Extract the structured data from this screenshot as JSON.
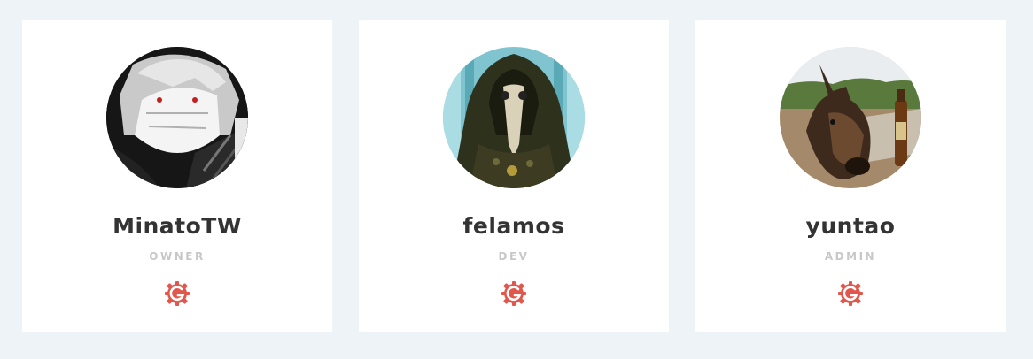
{
  "team": {
    "members": [
      {
        "name": "MinatoTW",
        "role": "OWNER",
        "avatar_icon": "anime-masked-character-avatar",
        "link_icon": "gitlab-gear-icon"
      },
      {
        "name": "felamos",
        "role": "DEV",
        "avatar_icon": "plague-doctor-avatar",
        "link_icon": "gitlab-gear-icon"
      },
      {
        "name": "yuntao",
        "role": "ADMIN",
        "avatar_icon": "donkey-with-beer-avatar",
        "link_icon": "gitlab-gear-icon"
      }
    ]
  },
  "colors": {
    "background": "#eef3f7",
    "card": "#ffffff",
    "name": "#333333",
    "role": "#c8c8c8",
    "icon": "#e2574c"
  }
}
